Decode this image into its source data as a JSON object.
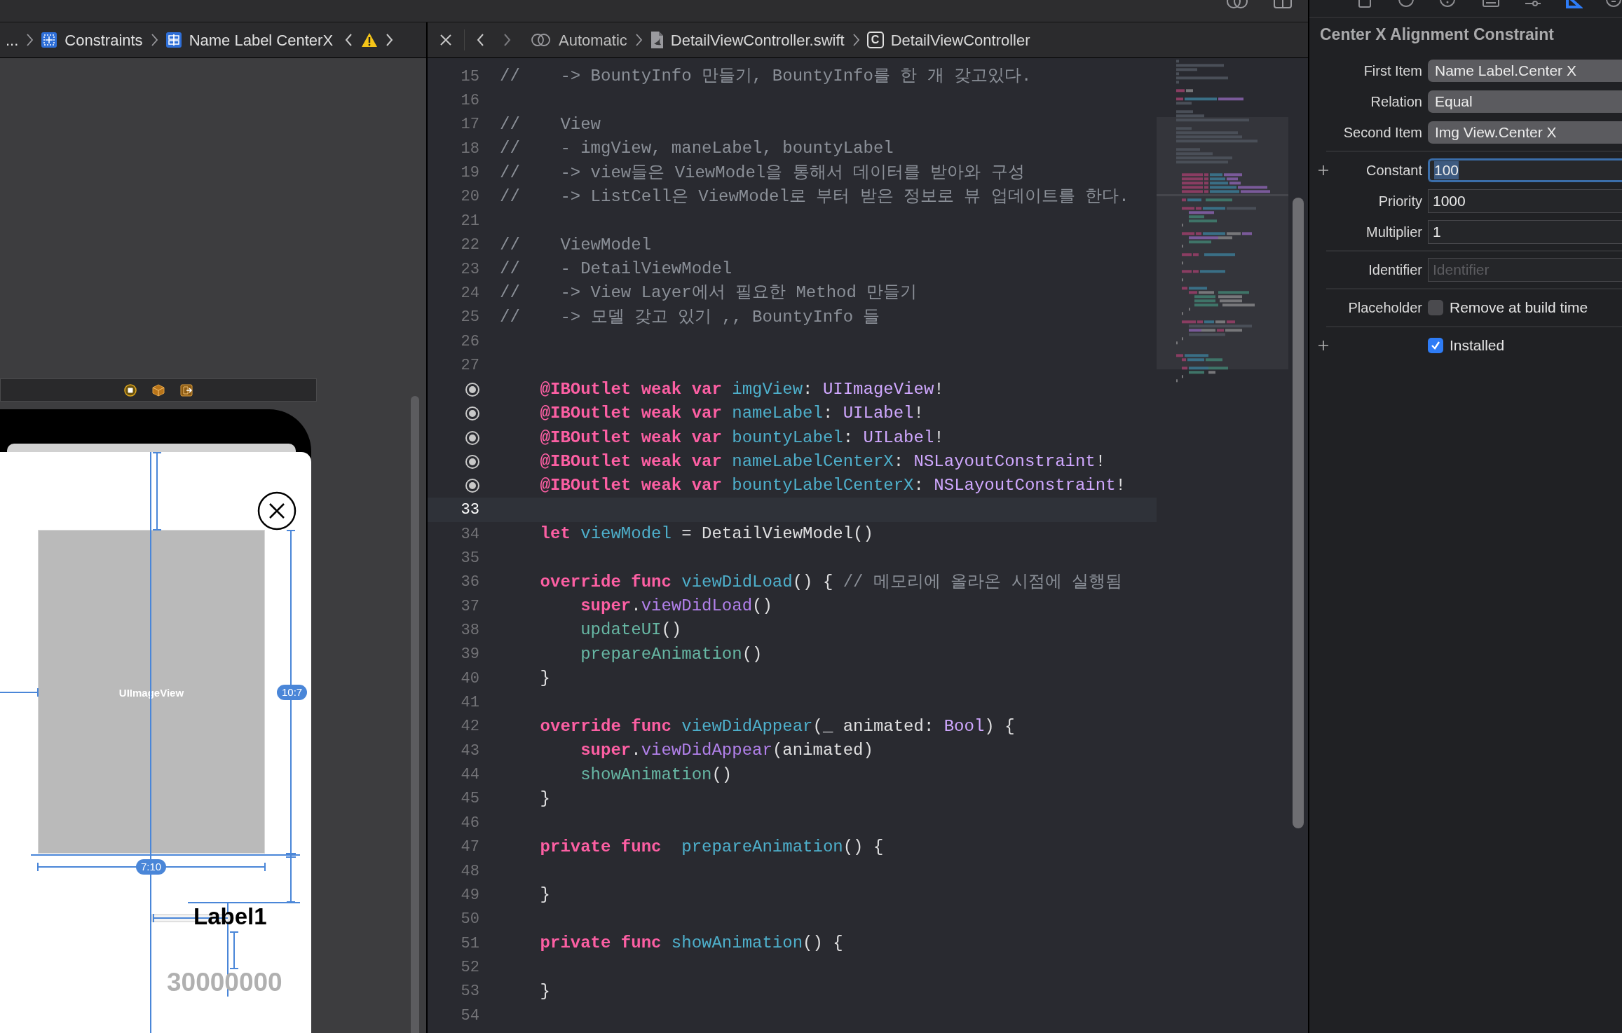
{
  "inspector_tabs": [
    {
      "kind": "file",
      "selected": false
    },
    {
      "kind": "history",
      "selected": false
    },
    {
      "kind": "help",
      "selected": false
    },
    {
      "kind": "identity",
      "selected": false
    },
    {
      "kind": "attributes",
      "selected": false
    },
    {
      "kind": "size",
      "selected": true
    },
    {
      "kind": "connections",
      "selected": false
    }
  ],
  "left_jump_bar": {
    "items": [
      {
        "kind": "ellipsis",
        "label": "..."
      },
      {
        "kind": "constraints",
        "label": "Constraints"
      },
      {
        "kind": "constraint",
        "label": "Name Label CenterX"
      }
    ],
    "has_warning": true
  },
  "right_jump_bar": {
    "mode": "Automatic",
    "items": [
      {
        "kind": "swift-file",
        "label": "DetailViewController.swift"
      },
      {
        "kind": "class",
        "label": "DetailViewController",
        "icon_letter": "C"
      }
    ]
  },
  "canvas": {
    "image_view_label": "UIImageView",
    "height_ratio": "10:7",
    "width_ratio": "7:10",
    "name_label": "Label1",
    "bounty_label": "30000000"
  },
  "editor": {
    "lines": [
      {
        "kind": "numbered",
        "number": "15",
        "current": false,
        "tokens": [
          {
            "text": "//    -> BountyInfo 만들기, BountyInfo를 한 개 갖고있다.",
            "kind": "comment"
          }
        ]
      },
      {
        "kind": "numbered",
        "number": "16",
        "current": false
      },
      {
        "kind": "numbered",
        "number": "17",
        "current": false,
        "tokens": [
          {
            "text": "//    View",
            "kind": "comment"
          }
        ]
      },
      {
        "kind": "numbered",
        "number": "18",
        "current": false,
        "tokens": [
          {
            "text": "//    - imgView, maneLabel, bountyLabel",
            "kind": "comment"
          }
        ]
      },
      {
        "kind": "numbered",
        "number": "19",
        "current": false,
        "tokens": [
          {
            "text": "//    -> view들은 ViewModel을 통해서 데이터를 받아와 구성",
            "kind": "comment"
          }
        ]
      },
      {
        "kind": "numbered",
        "number": "20",
        "current": false,
        "tokens": [
          {
            "text": "//    -> ListCell은 ViewModel로 부터 받은 정보로 뷰 업데이트를 한다.",
            "kind": "comment"
          }
        ]
      },
      {
        "kind": "numbered",
        "number": "21",
        "current": false
      },
      {
        "kind": "numbered",
        "number": "22",
        "current": false,
        "tokens": [
          {
            "text": "//    ViewModel",
            "kind": "comment"
          }
        ]
      },
      {
        "kind": "numbered",
        "number": "23",
        "current": false,
        "tokens": [
          {
            "text": "//    - DetailViewModel",
            "kind": "comment"
          }
        ]
      },
      {
        "kind": "numbered",
        "number": "24",
        "current": false,
        "tokens": [
          {
            "text": "//    -> View Layer에서 필요한 Method 만들기",
            "kind": "comment"
          }
        ]
      },
      {
        "kind": "numbered",
        "number": "25",
        "current": false,
        "tokens": [
          {
            "text": "//    -> 모델 갖고 있기 ,, BountyInfo 들",
            "kind": "comment"
          }
        ]
      },
      {
        "kind": "numbered",
        "number": "26",
        "current": false
      },
      {
        "kind": "numbered",
        "number": "27",
        "current": false
      },
      {
        "kind": "outlet",
        "current": false,
        "tokens": [
          {
            "text": "    @IBOutlet weak var",
            "kind": "keyword"
          },
          {
            "text": " imgView",
            "kind": "decl"
          },
          {
            "text": ": ",
            "kind": "plain"
          },
          {
            "text": "UIImageView",
            "kind": "type"
          },
          {
            "text": "!",
            "kind": "plain"
          }
        ]
      },
      {
        "kind": "outlet",
        "current": false,
        "tokens": [
          {
            "text": "    @IBOutlet weak var",
            "kind": "keyword"
          },
          {
            "text": " nameLabel",
            "kind": "decl"
          },
          {
            "text": ": ",
            "kind": "plain"
          },
          {
            "text": "UILabel",
            "kind": "type"
          },
          {
            "text": "!",
            "kind": "plain"
          }
        ]
      },
      {
        "kind": "outlet",
        "current": false,
        "tokens": [
          {
            "text": "    @IBOutlet weak var",
            "kind": "keyword"
          },
          {
            "text": " bountyLabel",
            "kind": "decl"
          },
          {
            "text": ": ",
            "kind": "plain"
          },
          {
            "text": "UILabel",
            "kind": "type"
          },
          {
            "text": "!",
            "kind": "plain"
          }
        ]
      },
      {
        "kind": "outlet",
        "current": false,
        "tokens": [
          {
            "text": "    @IBOutlet weak var",
            "kind": "keyword"
          },
          {
            "text": " nameLabelCenterX",
            "kind": "decl"
          },
          {
            "text": ": ",
            "kind": "plain"
          },
          {
            "text": "NSLayoutConstraint",
            "kind": "type"
          },
          {
            "text": "!",
            "kind": "plain"
          }
        ]
      },
      {
        "kind": "outlet",
        "current": false,
        "tokens": [
          {
            "text": "    @IBOutlet weak var",
            "kind": "keyword"
          },
          {
            "text": " bountyLabelCenterX",
            "kind": "decl"
          },
          {
            "text": ": ",
            "kind": "plain"
          },
          {
            "text": "NSLayoutConstraint",
            "kind": "type"
          },
          {
            "text": "!",
            "kind": "plain"
          }
        ]
      },
      {
        "kind": "numbered",
        "number": "33",
        "current": true
      },
      {
        "kind": "numbered",
        "number": "34",
        "current": false,
        "tokens": [
          {
            "text": "    let",
            "kind": "keyword"
          },
          {
            "text": " viewModel",
            "kind": "decl"
          },
          {
            "text": " = DetailViewModel()",
            "kind": "plain"
          }
        ]
      },
      {
        "kind": "numbered",
        "number": "35",
        "current": false
      },
      {
        "kind": "numbered",
        "number": "36",
        "current": false,
        "tokens": [
          {
            "text": "    override func",
            "kind": "keyword"
          },
          {
            "text": " viewDidLoad",
            "kind": "decl"
          },
          {
            "text": "() { ",
            "kind": "plain"
          },
          {
            "text": "// 메모리에 올라온 시점에 실행됨",
            "kind": "comment"
          }
        ]
      },
      {
        "kind": "numbered",
        "number": "37",
        "current": false,
        "tokens": [
          {
            "text": "        super",
            "kind": "keyword"
          },
          {
            "text": ".",
            "kind": "plain"
          },
          {
            "text": "viewDidLoad",
            "kind": "system"
          },
          {
            "text": "()",
            "kind": "plain"
          }
        ]
      },
      {
        "kind": "numbered",
        "number": "38",
        "current": false,
        "tokens": [
          {
            "text": "        updateUI",
            "kind": "call"
          },
          {
            "text": "()",
            "kind": "plain"
          }
        ]
      },
      {
        "kind": "numbered",
        "number": "39",
        "current": false,
        "tokens": [
          {
            "text": "        prepareAnimation",
            "kind": "call"
          },
          {
            "text": "()",
            "kind": "plain"
          }
        ]
      },
      {
        "kind": "numbered",
        "number": "40",
        "current": false,
        "tokens": [
          {
            "text": "    }",
            "kind": "plain"
          }
        ]
      },
      {
        "kind": "numbered",
        "number": "41",
        "current": false
      },
      {
        "kind": "numbered",
        "number": "42",
        "current": false,
        "tokens": [
          {
            "text": "    override func",
            "kind": "keyword"
          },
          {
            "text": " viewDidAppear",
            "kind": "decl"
          },
          {
            "text": "(_ animated: ",
            "kind": "plain"
          },
          {
            "text": "Bool",
            "kind": "type"
          },
          {
            "text": ") {",
            "kind": "plain"
          }
        ]
      },
      {
        "kind": "numbered",
        "number": "43",
        "current": false,
        "tokens": [
          {
            "text": "        super",
            "kind": "keyword"
          },
          {
            "text": ".",
            "kind": "plain"
          },
          {
            "text": "viewDidAppear",
            "kind": "system"
          },
          {
            "text": "(animated)",
            "kind": "plain"
          }
        ]
      },
      {
        "kind": "numbered",
        "number": "44",
        "current": false,
        "tokens": [
          {
            "text": "        showAnimation",
            "kind": "call"
          },
          {
            "text": "()",
            "kind": "plain"
          }
        ]
      },
      {
        "kind": "numbered",
        "number": "45",
        "current": false,
        "tokens": [
          {
            "text": "    }",
            "kind": "plain"
          }
        ]
      },
      {
        "kind": "numbered",
        "number": "46",
        "current": false
      },
      {
        "kind": "numbered",
        "number": "47",
        "current": false,
        "tokens": [
          {
            "text": "    private func",
            "kind": "keyword"
          },
          {
            "text": "  prepareAnimation",
            "kind": "decl"
          },
          {
            "text": "() {",
            "kind": "plain"
          }
        ]
      },
      {
        "kind": "numbered",
        "number": "48",
        "current": false
      },
      {
        "kind": "numbered",
        "number": "49",
        "current": false,
        "tokens": [
          {
            "text": "    }",
            "kind": "plain"
          }
        ]
      },
      {
        "kind": "numbered",
        "number": "50",
        "current": false
      },
      {
        "kind": "numbered",
        "number": "51",
        "current": false,
        "tokens": [
          {
            "text": "    private func",
            "kind": "keyword"
          },
          {
            "text": " showAnimation",
            "kind": "decl"
          },
          {
            "text": "() {",
            "kind": "plain"
          }
        ]
      },
      {
        "kind": "numbered",
        "number": "52",
        "current": false
      },
      {
        "kind": "numbered",
        "number": "53",
        "current": false,
        "tokens": [
          {
            "text": "    }",
            "kind": "plain"
          }
        ]
      },
      {
        "kind": "numbered",
        "number": "54",
        "current": false
      }
    ]
  },
  "inspector": {
    "title": "Center X Alignment Constraint",
    "groups": [
      [
        {
          "kind": "popup",
          "label": "First Item",
          "value": "Name Label.Center X"
        },
        {
          "kind": "popup",
          "label": "Relation",
          "value": "Equal"
        },
        {
          "kind": "popup",
          "label": "Second Item",
          "value": "Img View.Center X"
        }
      ],
      [
        {
          "kind": "field",
          "label": "Constant",
          "value": "100",
          "focused": true,
          "has_plus": true
        },
        {
          "kind": "field",
          "label": "Priority",
          "value": "1000",
          "focused": false,
          "has_plus": false
        },
        {
          "kind": "field",
          "label": "Multiplier",
          "value": "1",
          "focused": false,
          "has_plus": false
        }
      ],
      [
        {
          "kind": "field",
          "label": "Identifier",
          "placeholder": "Identifier",
          "focused": false,
          "has_plus": false
        }
      ],
      [
        {
          "kind": "checkbox",
          "label": "Placeholder",
          "text": "Remove at build time",
          "checked": false,
          "has_plus": false
        }
      ],
      [
        {
          "kind": "checkbox",
          "text": "Installed",
          "checked": true,
          "has_plus": true
        }
      ]
    ]
  }
}
